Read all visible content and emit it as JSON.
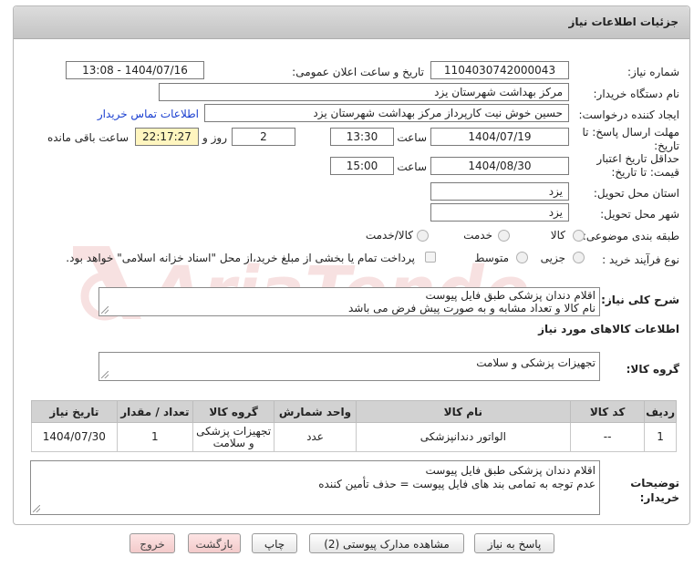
{
  "header": {
    "title": "جزئیات اطلاعات نیاز"
  },
  "need_number": {
    "label": "شماره نیاز:",
    "value": "1104030742000043"
  },
  "announce": {
    "label": "تاریخ و ساعت اعلان عمومی:",
    "value": "1404/07/16 - 13:08"
  },
  "buyer_org": {
    "label": "نام دستگاه خریدار:",
    "value": "مرکز بهداشت شهرستان یزد"
  },
  "requester": {
    "label": "ایجاد کننده درخواست:",
    "value": "حسین خوش نیت کارپرداز مرکز بهداشت شهرستان یزد",
    "contact_link": "اطلاعات تماس خریدار"
  },
  "reply_deadline": {
    "label": "مهلت ارسال پاسخ: تا تاریخ:",
    "date": "1404/07/19",
    "time_label": "ساعت",
    "time": "13:30",
    "days": "2",
    "days_label": "روز و",
    "remaining": "22:17:27",
    "remaining_label": "ساعت باقی مانده"
  },
  "price_validity": {
    "label": "حداقل تاریخ اعتبار قیمت: تا تاریخ:",
    "date": "1404/08/30",
    "time_label": "ساعت",
    "time": "15:00"
  },
  "delivery_province": {
    "label": "استان محل تحویل:",
    "value": "یزد"
  },
  "delivery_city": {
    "label": "شهر محل تحویل:",
    "value": "یزد"
  },
  "category": {
    "label": "طبقه بندی موضوعی:",
    "options": [
      "کالا",
      "خدمت",
      "کالا/خدمت"
    ],
    "selected": "کالا"
  },
  "process": {
    "label": "نوع فرآیند خرید :",
    "options": [
      "جزیی",
      "متوسط"
    ],
    "payment_note": "پرداخت تمام یا بخشی از مبلغ خرید،از محل \"اسناد خزانه اسلامی\" خواهد بود."
  },
  "description": {
    "label": "شرح کلی نیاز:",
    "line1": "اقلام دندان پزشکی طبق فایل پیوست",
    "line2": "نام کالا و تعداد مشابه و به صورت پیش فرض می باشد"
  },
  "goods_info": {
    "title": "اطلاعات کالاهای مورد نیاز"
  },
  "goods_group": {
    "label": "گروه کالا:",
    "value": "تجهیزات پزشکی و سلامت"
  },
  "table": {
    "headers": [
      "ردیف",
      "کد کالا",
      "نام کالا",
      "واحد شمارش",
      "گروه کالا",
      "تعداد / مقدار",
      "تاریخ نیاز"
    ],
    "rows": [
      {
        "row": "1",
        "code": "--",
        "name": "الواتور دندانپزشکی",
        "unit": "عدد",
        "group": "تجهیزات پزشکی و سلامت",
        "qty": "1",
        "date": "1404/07/30"
      }
    ]
  },
  "buyer_notes": {
    "label": "توضیحات خریدار:",
    "line1": "اقلام دندان پزشکی طبق فایل پیوست",
    "line2": "عدم توجه به تمامی بند های فایل پیوست = حذف تأمین کننده"
  },
  "buttons": {
    "reply": "پاسخ به نیاز",
    "attachments": "مشاهده مدارک پیوستی (2)",
    "print": "چاپ",
    "back": "بازگشت",
    "exit": "خروج"
  },
  "colors": {
    "link": "#1a3fd0",
    "highlight": "#fff5bf",
    "header_bg": "#d0d0d0",
    "danger_btn": "#f3caca"
  },
  "watermark": {
    "text": "AriaTender.net"
  }
}
